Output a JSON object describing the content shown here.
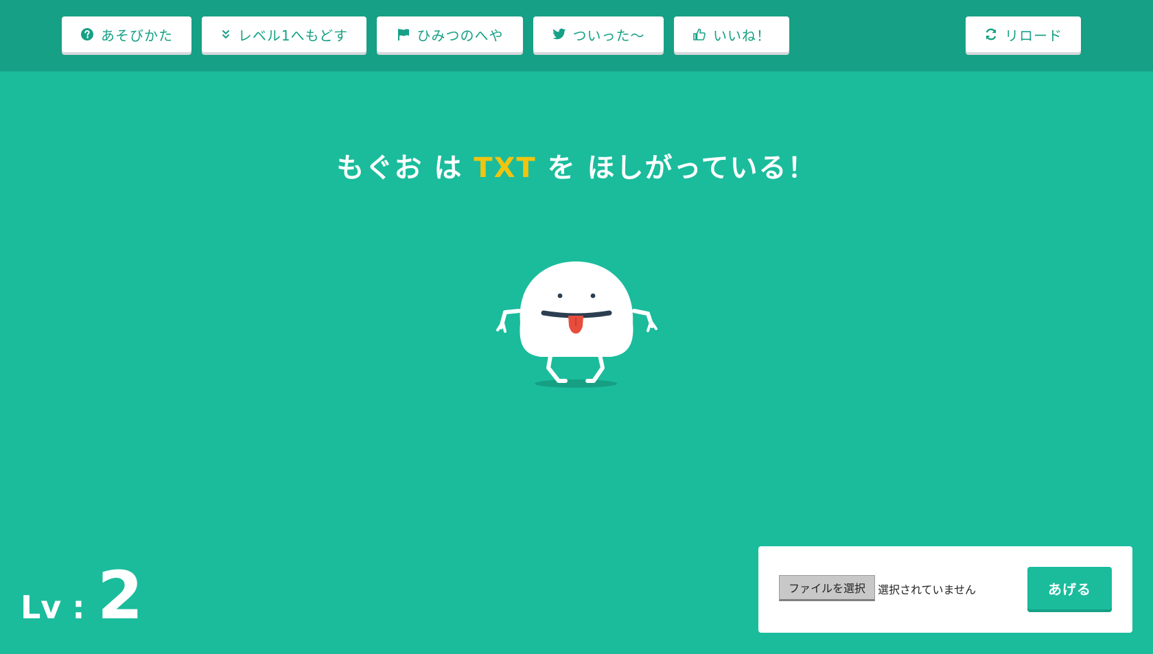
{
  "nav": {
    "howto_label": "あそびかた",
    "reset_label": "レベル1へもどす",
    "secret_label": "ひみつのへや",
    "tweet_label": "ついった〜",
    "like_label": "いいね！",
    "reload_label": "リロード"
  },
  "icons": {
    "howto": "question-circle-icon",
    "reset": "double-chevron-down-icon",
    "secret": "flag-icon",
    "tweet": "twitter-bird-icon",
    "like": "thumbs-up-icon",
    "reload": "refresh-icon"
  },
  "headline": {
    "prefix": "もぐお は ",
    "wanted": "TXT",
    "suffix": " を ほしがっている！"
  },
  "level": {
    "label": "Lv :",
    "value": "2"
  },
  "upload": {
    "file_button_label": "ファイルを選択",
    "file_status": "選択されていません",
    "give_button_label": "あげる"
  },
  "colors": {
    "background": "#1abc9c",
    "topbar": "#16a085",
    "accent_text": "#f1c40f",
    "button_text": "#16a085",
    "tongue": "#e74c3c"
  }
}
